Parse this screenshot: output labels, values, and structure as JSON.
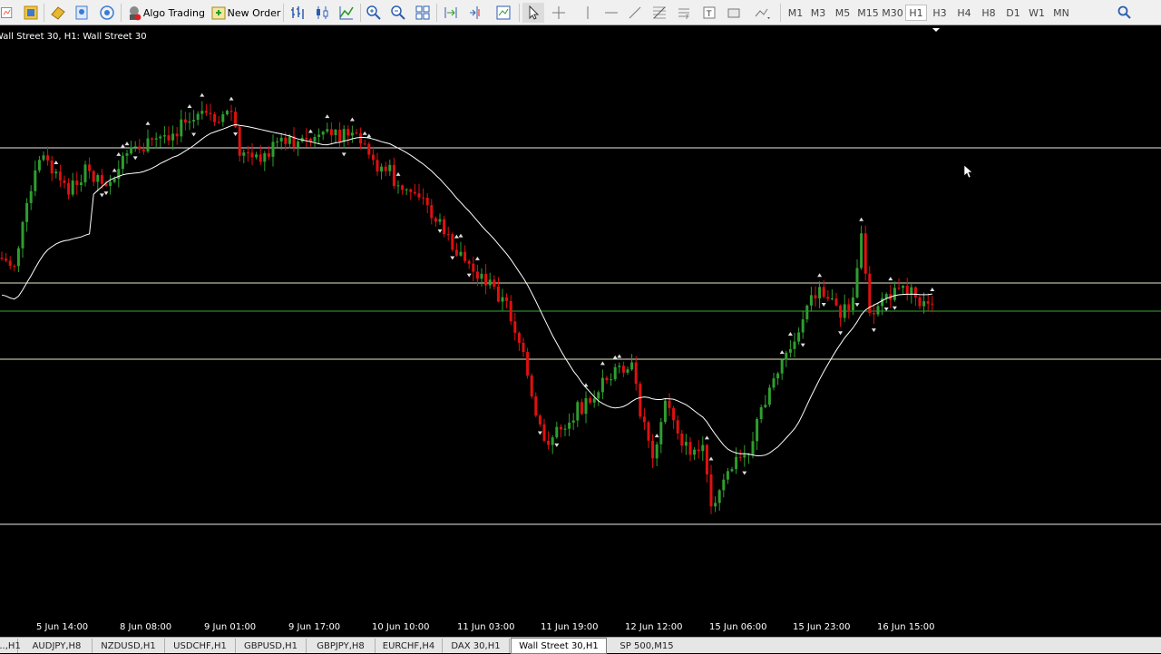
{
  "toolbar": {
    "algo_trading_label": "Algo Trading",
    "new_order_label": "New Order",
    "timeframes": [
      "M1",
      "M3",
      "M5",
      "M15",
      "M30",
      "H1",
      "H3",
      "H4",
      "H8",
      "D1",
      "W1",
      "MN"
    ],
    "active_timeframe": "H1"
  },
  "chart": {
    "title": "Wall Street 30, H1:  Wall Street 30",
    "background": "#000000",
    "bull_color": "#2e9e2e",
    "bear_color": "#e01010",
    "ma_color": "#ffffff",
    "time_labels": [
      "5 Jun 14:00",
      "8 Jun 08:00",
      "9 Jun 01:00",
      "9 Jun 17:00",
      "10 Jun 10:00",
      "11 Jun 03:00",
      "11 Jun 19:00",
      "12 Jun 12:00",
      "15 Jun 06:00",
      "15 Jun 23:00",
      "16 Jun 15:00"
    ]
  },
  "tabs": {
    "items": [
      "...,H1",
      "AUDJPY,H8",
      "NZDUSD,H1",
      "USDCHF,H1",
      "GBPUSD,H1",
      "GBPJPY,H8",
      "EURCHF,H4",
      "DAX 30,H1",
      "Wall Street 30,H1",
      "SP 500,M15"
    ],
    "active": "Wall Street 30,H1"
  }
}
